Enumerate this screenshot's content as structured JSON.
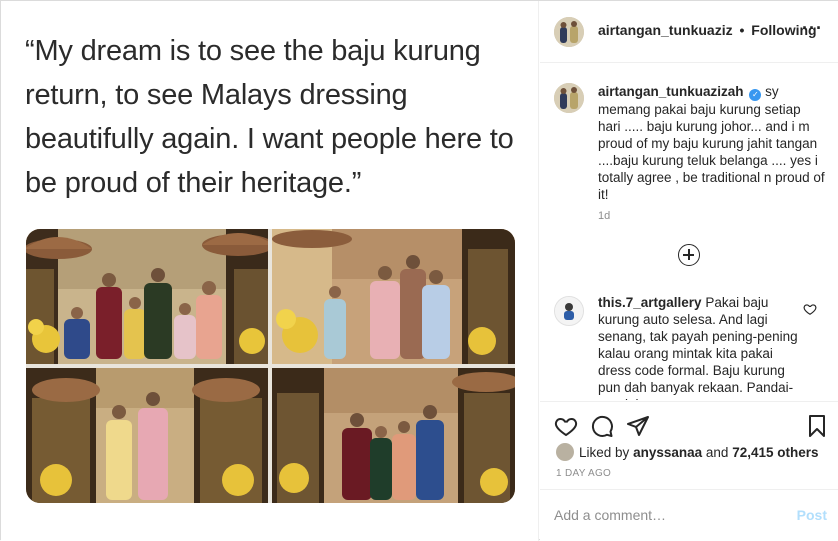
{
  "media": {
    "quote": "“My dream is to see the baju kurung return, to see Malays dressing beautifully again. I want people here to be proud of their heritage.”"
  },
  "header": {
    "username": "airtangan_tunkuaziz",
    "separator": "•",
    "follow_status": "Following",
    "more_icon": "more-horizontal-icon"
  },
  "caption": {
    "username": "airtangan_tunkuazizah",
    "verified_icon": "verified-badge-icon",
    "text": "sy memang pakai baju kurung setiap hari ..... baju kurung johor... and i m proud of my baju kurung jahit tangan ....baju kurung teluk belanga .... yes i totally agree , be traditional n proud of it!",
    "time": "1d"
  },
  "load_more_icon": "plus-circle-icon",
  "comments": [
    {
      "username": "this.7_artgallery",
      "text": "Pakai baju kurung auto selesa. And lagi senang, tak payah pening-pening kalau orang mintak kita pakai dress code formal. Baju kurung pun dah banyak rekaan. Pandai-pandai",
      "like_icon": "heart-outline-icon"
    }
  ],
  "actions": {
    "icons": [
      "heart-icon",
      "comment-icon",
      "share-icon",
      "bookmark-icon"
    ],
    "liked_by_prefix": "Liked by",
    "liked_by_user": "anyssanaa",
    "liked_by_joiner": "and",
    "liked_by_count": "72,415 others",
    "post_time": "1 DAY AGO"
  },
  "add_comment": {
    "placeholder": "Add a comment…",
    "post_label": "Post"
  },
  "colors": {
    "verified": "#3897f0",
    "post_disabled": "#b2dffc",
    "meta_gray": "#8e8e8e"
  }
}
